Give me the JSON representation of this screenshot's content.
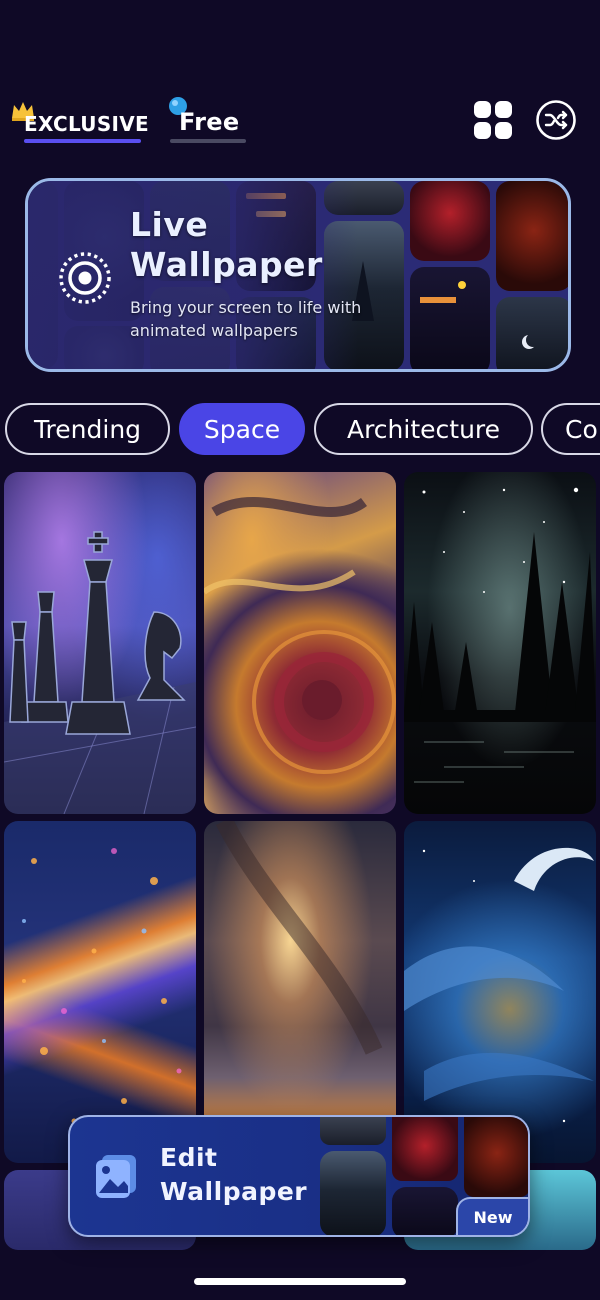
{
  "top_tabs": [
    {
      "label": "EXCLUSIVE",
      "icon": "crown-icon",
      "active": true
    },
    {
      "label": "Free",
      "icon": "gem-icon",
      "active": false
    }
  ],
  "header_actions": [
    {
      "name": "grid-view",
      "icon": "grid-icon"
    },
    {
      "name": "shuffle",
      "icon": "shuffle-icon"
    }
  ],
  "banner": {
    "title_line1": "Live",
    "title_line2": "Wallpaper",
    "subtitle_line1": "Bring your screen to life with",
    "subtitle_line2": "animated wallpapers",
    "icon": "live-target-icon"
  },
  "categories": [
    {
      "label": "Trending",
      "active": false
    },
    {
      "label": "Space",
      "active": true
    },
    {
      "label": "Architecture",
      "active": false
    },
    {
      "label": "Co",
      "active": false
    }
  ],
  "wallpapers": [
    {
      "theme": "chess-pieces-space"
    },
    {
      "theme": "marble-swirl"
    },
    {
      "theme": "starry-forest-lake"
    },
    {
      "theme": "glowing-galaxy-trail"
    },
    {
      "theme": "milky-way-sunset"
    },
    {
      "theme": "blue-cosmic-wave"
    }
  ],
  "edit_bar": {
    "label_line1": "Edit",
    "label_line2": "Wallpaper",
    "badge": "New",
    "icon": "image-edit-icon"
  },
  "colors": {
    "background": "#0f0926",
    "accent": "#4a45e6",
    "crown": "#f7c23a",
    "gem": "#2ea0e6",
    "banner_border": "#9bb9e8"
  }
}
